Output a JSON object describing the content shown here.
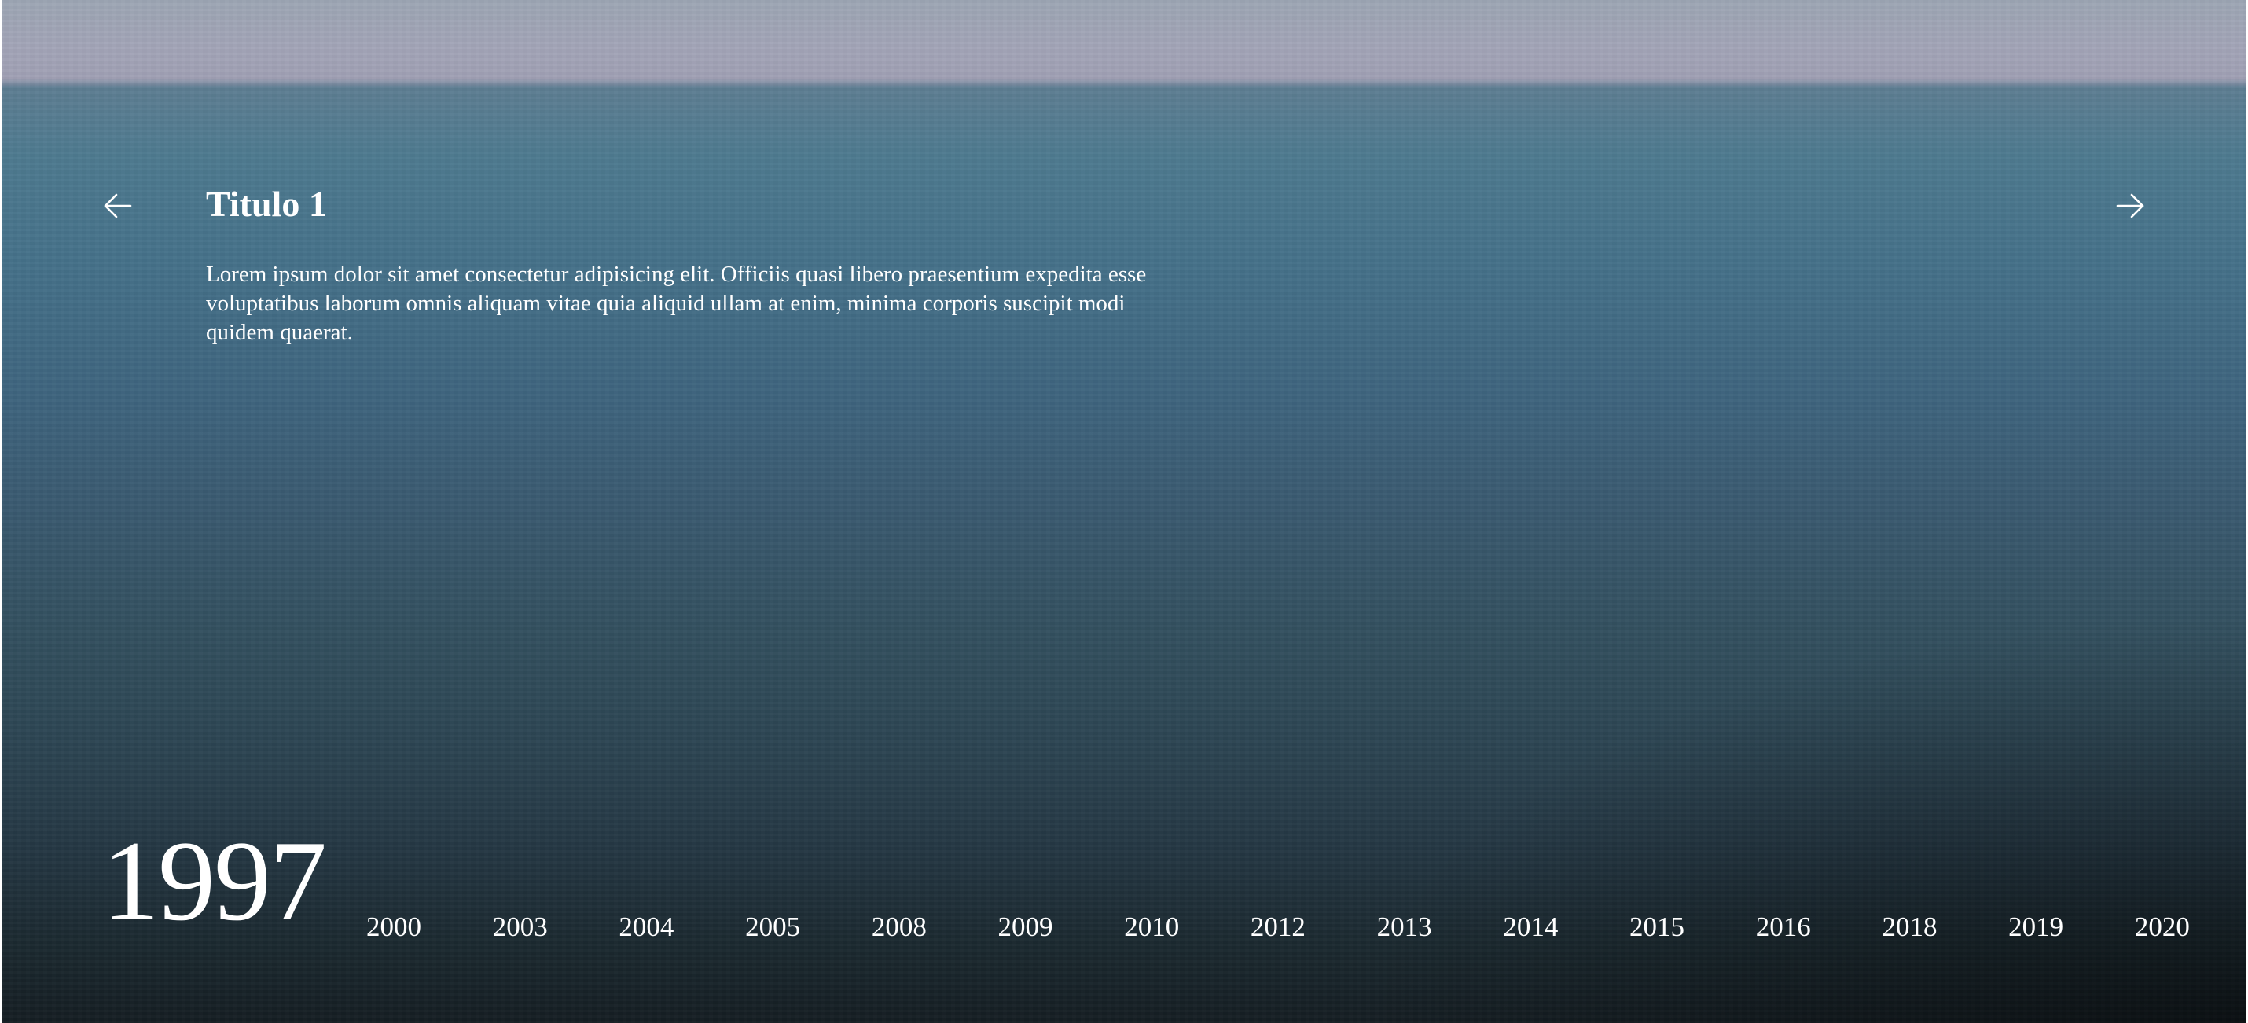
{
  "slide": {
    "title": "Titulo 1",
    "description": "Lorem ipsum dolor sit amet consectetur adipisicing elit. Officiis quasi libero praesentium expedita esse voluptatibus laborum omnis aliquam vitae quia aliquid ullam at enim, minima corporis suscipit modi quidem quaerat."
  },
  "navigation": {
    "prev_icon": "arrow-left-icon",
    "next_icon": "arrow-right-icon"
  },
  "timeline": {
    "current_year": "1997",
    "years": [
      "2000",
      "2003",
      "2004",
      "2005",
      "2008",
      "2009",
      "2010",
      "2012",
      "2013",
      "2014",
      "2015",
      "2016",
      "2018",
      "2019",
      "2020"
    ]
  },
  "colors": {
    "text": "#ffffff",
    "sky": "#a3a5b8",
    "sea_top": "#4e7a90",
    "sea_bottom": "#141d22"
  }
}
